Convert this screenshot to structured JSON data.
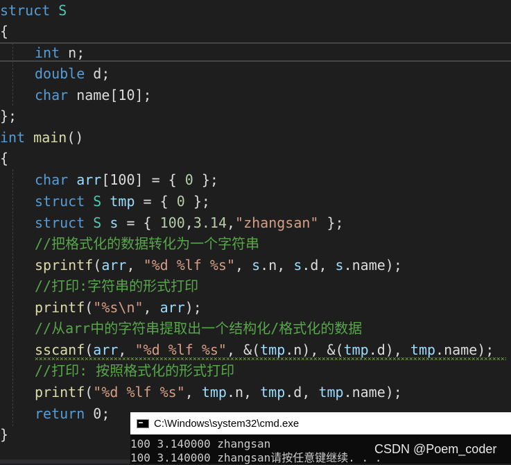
{
  "editor": {
    "l1": {
      "a": "struct",
      "b": " ",
      "c": "S"
    },
    "l2": {
      "a": "{"
    },
    "l3": {
      "a": "int",
      "b": " n;"
    },
    "l4": {
      "a": "double",
      "b": " d;"
    },
    "l5": {
      "a": "char",
      "b": " name[10];"
    },
    "l6": {
      "a": "};"
    },
    "l7": {
      "a": "int",
      "b": " ",
      "c": "main",
      "d": "()"
    },
    "l8": {
      "a": "{"
    },
    "l9": {
      "a": "char",
      "b": " ",
      "c": "arr",
      "d": "[100] = { ",
      "e": "0",
      "f": " };"
    },
    "l10": {
      "a": "struct",
      "b": " ",
      "c": "S",
      "d": " ",
      "e": "tmp",
      "f": " = { ",
      "g": "0",
      "h": " };"
    },
    "l11": {
      "a": "struct",
      "b": " ",
      "c": "S",
      "d": " ",
      "e": "s",
      "f": " = { ",
      "g": "100",
      "h": ",",
      "i": "3.14",
      "j": ",",
      "k": "\"zhangsan\"",
      "l": " };"
    },
    "l12": {
      "a": "//把格式化的数据转化为一个字符串"
    },
    "l13": {
      "a": "sprintf",
      "b": "(",
      "c": "arr",
      "d": ", ",
      "e": "\"%d %lf %s\"",
      "f": ", ",
      "g": "s",
      "h": ".n, ",
      "i": "s",
      "j": ".d, ",
      "k": "s",
      "l": ".name);"
    },
    "l14": {
      "a": "//打印:字符串的形式打印"
    },
    "l15": {
      "a": "printf",
      "b": "(",
      "c": "\"%s\\n\"",
      "d": ", ",
      "e": "arr",
      "f": ");"
    },
    "l16": {
      "a": "//从arr中的字符串提取出一个结构化/格式化的数据"
    },
    "l17": {
      "a": "sscanf",
      "b": "(",
      "c": "arr",
      "d": ", ",
      "e": "\"%d %lf %s\"",
      "f": ", &(",
      "g": "tmp",
      "h": ".n), &(",
      "i": "tmp",
      "j": ".d), ",
      "k": "tmp",
      "l": ".name);"
    },
    "l18": {
      "a": "//打印: 按照格式化的形式打印"
    },
    "l19": {
      "a": "printf",
      "b": "(",
      "c": "\"%d %lf %s\"",
      "d": ", ",
      "e": "tmp",
      "f": ".n, ",
      "g": "tmp",
      "h": ".d, ",
      "i": "tmp",
      "j": ".name);"
    },
    "l20": {
      "a": "return",
      "b": " 0;"
    },
    "l21": {
      "a": "}"
    }
  },
  "console": {
    "title": "C:\\Windows\\system32\\cmd.exe",
    "line1": "100 3.140000 zhangsan",
    "line2": "100 3.140000 zhangsan请按任意键继续. . ."
  },
  "watermark": "CSDN @Poem_coder",
  "colors": {
    "background": "#1e1e1e",
    "keyword": "#569cd6",
    "type": "#4ec9b0",
    "function": "#dcdcaa",
    "variable": "#9cdcfe",
    "string": "#d69d85",
    "number": "#b5cea8",
    "comment": "#57a64a",
    "console_bg": "#0c0c0c"
  }
}
